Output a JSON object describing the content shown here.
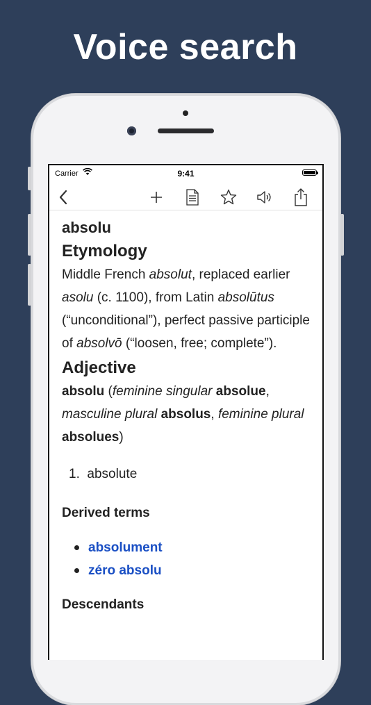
{
  "headline": "Voice search",
  "status_bar": {
    "carrier": "Carrier",
    "time": "9:41"
  },
  "toolbar": {
    "back_icon": "chevron-left-icon",
    "add_icon": "plus-icon",
    "document_icon": "document-icon",
    "favorite_icon": "star-icon",
    "speak_icon": "speaker-icon",
    "share_icon": "share-icon"
  },
  "entry": {
    "word": "absolu",
    "etymology_heading": "Etymology",
    "etymology": [
      {
        "t": "Middle French ",
        "i": false
      },
      {
        "t": "absolut",
        "i": true
      },
      {
        "t": ", replaced earlier ",
        "i": false
      },
      {
        "t": "asolu",
        "i": true
      },
      {
        "t": " (c. 1100), from Latin ",
        "i": false
      },
      {
        "t": "absolūtus",
        "i": true
      },
      {
        "t": " (“unconditional”), perfect passive participle of ",
        "i": false
      },
      {
        "t": "absolvō",
        "i": true
      },
      {
        "t": " (“loosen, free; complete”).",
        "i": false
      }
    ],
    "pos_heading": "Adjective",
    "inflection": [
      {
        "t": "absolu",
        "s": "b"
      },
      {
        "t": " (",
        "s": "n"
      },
      {
        "t": "feminine singular",
        "s": "i"
      },
      {
        "t": " ",
        "s": "n"
      },
      {
        "t": "absolue",
        "s": "b"
      },
      {
        "t": ", ",
        "s": "n"
      },
      {
        "t": "masculine plural",
        "s": "i"
      },
      {
        "t": " ",
        "s": "n"
      },
      {
        "t": "absolus",
        "s": "b"
      },
      {
        "t": ", ",
        "s": "n"
      },
      {
        "t": "feminine plural",
        "s": "i"
      },
      {
        "t": " ",
        "s": "n"
      },
      {
        "t": "absolues",
        "s": "b"
      },
      {
        "t": ")",
        "s": "n"
      }
    ],
    "definition_number": "1.",
    "definition": "absolute",
    "derived_heading": "Derived terms",
    "derived_terms": [
      "absolument",
      "zéro absolu"
    ],
    "descendants_heading": "Descendants"
  },
  "colors": {
    "background": "#2e3f5a",
    "link": "#1a4fc4"
  }
}
